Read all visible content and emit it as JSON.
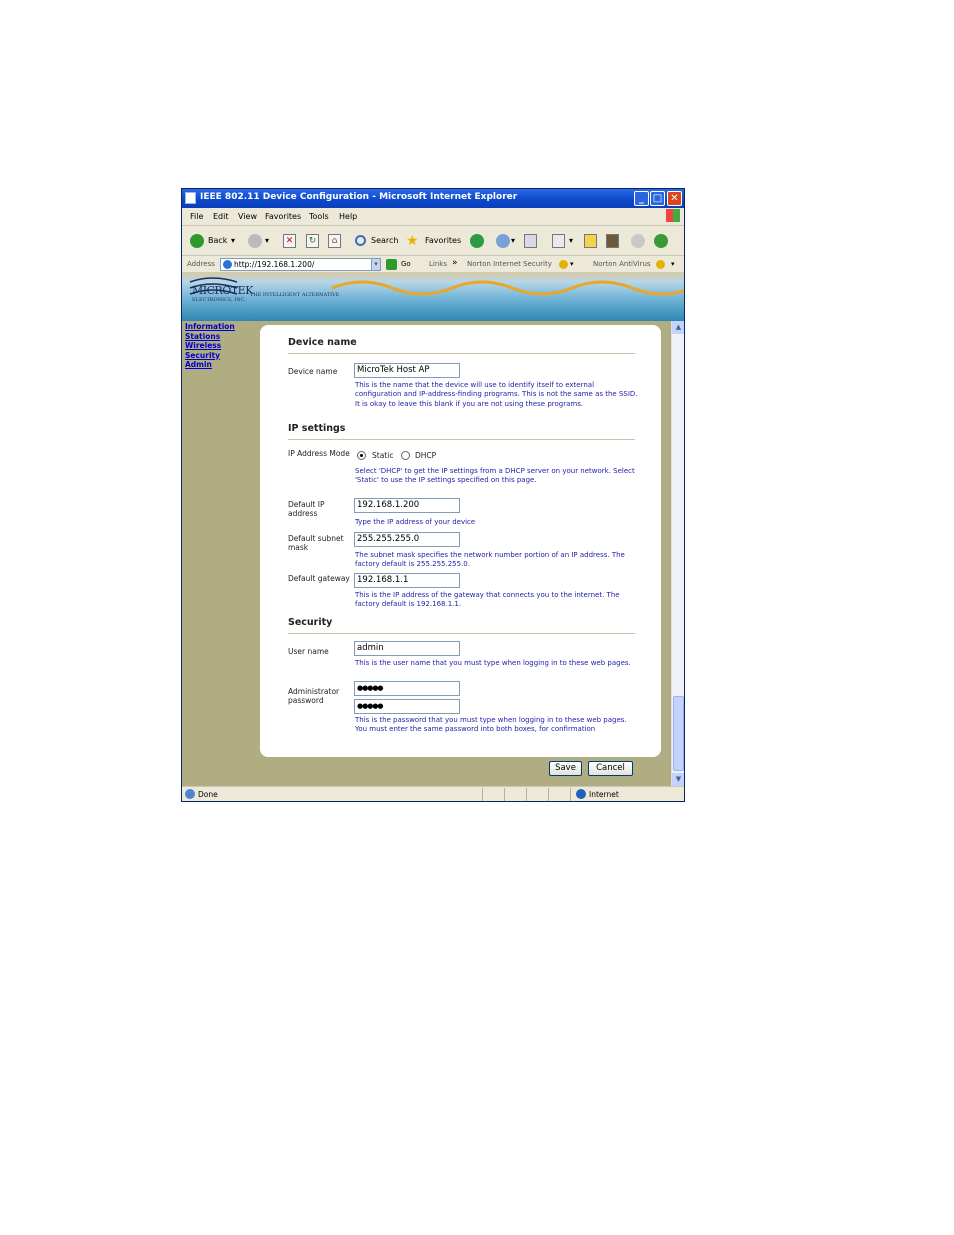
{
  "window": {
    "title": "IEEE 802.11 Device Configuration - Microsoft Internet Explorer",
    "minimize": "_",
    "maximize": "□",
    "close": "✕"
  },
  "menu": {
    "file": "File",
    "edit": "Edit",
    "view": "View",
    "favorites": "Favorites",
    "tools": "Tools",
    "help": "Help"
  },
  "toolbar": {
    "back": "Back",
    "search": "Search",
    "favorites": "Favorites",
    "dropdown": "▾"
  },
  "address": {
    "label": "Address",
    "url": "http://192.168.1.200/",
    "go": "Go",
    "links": "Links",
    "links_more": "»",
    "norton_security": "Norton Internet Security",
    "norton_antivirus": "Norton AntiVirus"
  },
  "banner": {
    "logo": "MICROTEK",
    "logo_sub": "ELECTRONICS, INC.",
    "tagline": "THE INTELLIGENT ALTERNATIVE"
  },
  "nav": [
    "Information",
    "Stations",
    "Wireless",
    "Security",
    "Admin"
  ],
  "form": {
    "device_section": "Device name",
    "device_label": "Device name",
    "device_value": "MicroTek Host AP",
    "device_help": "This is the name that the device will use to identify itself to external configuration and IP-address-finding programs. This is not the same as the SSID. It is okay to leave this blank if you are not using these programs.",
    "ip_section": "IP settings",
    "ip_mode_label": "IP Address Mode",
    "ip_mode_static": "Static",
    "ip_mode_dhcp": "DHCP",
    "ip_mode_help": "Select 'DHCP' to get the IP settings from a DHCP server on your network. Select 'Static' to use the IP settings specified on this page.",
    "ip_label": "Default IP address",
    "ip_value": "192.168.1.200",
    "ip_help": "Type the IP address of your device",
    "mask_label": "Default subnet mask",
    "mask_value": "255.255.255.0",
    "mask_help": "The subnet mask specifies the network number portion of an IP address. The factory default is 255.255.255.0.",
    "gw_label": "Default gateway",
    "gw_value": "192.168.1.1",
    "gw_help": "This is the IP address of the gateway that connects you to the internet. The factory default is 192.168.1.1.",
    "sec_section": "Security",
    "user_label": "User name",
    "user_value": "admin",
    "user_help": "This is the user name that you must type when logging in to these web pages.",
    "pw_label": "Administrator password",
    "pw_value": "●●●●●",
    "pw_confirm_value": "●●●●●",
    "pw_help": "This is the password that you must type when logging in to these web pages. You must enter the same password into both boxes, for confirmation",
    "save": "Save",
    "cancel": "Cancel"
  },
  "scrollbar": {
    "up": "▲",
    "down": "▼"
  },
  "status": {
    "left": "Done",
    "zone": "Internet"
  }
}
